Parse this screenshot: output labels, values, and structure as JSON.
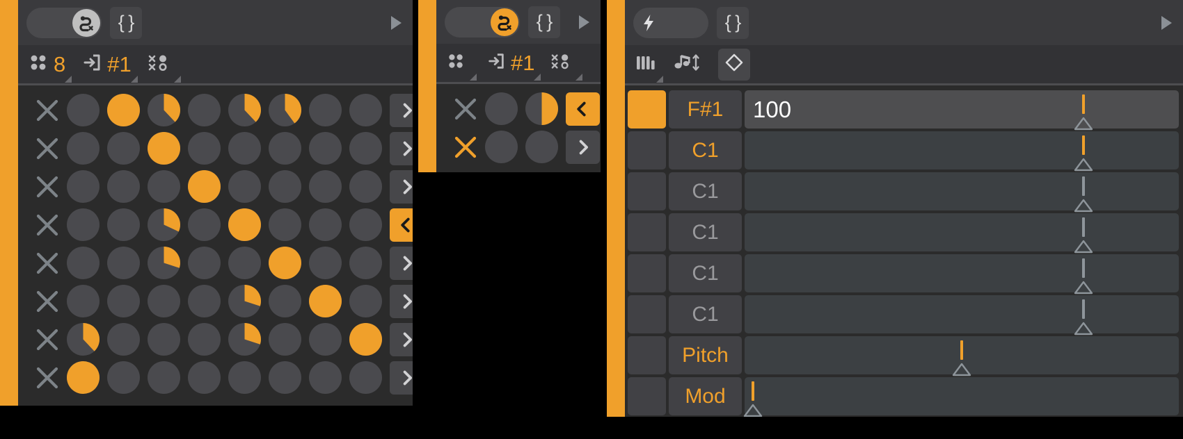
{
  "app": {
    "background": "#000000",
    "accent": "#f0a02b",
    "panel_bg": "#2b2b2b",
    "header_bg": "#3a3a3d",
    "toolbar_bg": "#323235",
    "step_off": "#4a4a4e"
  },
  "modules": [
    {
      "id": "probability",
      "name": "probability-sequencer",
      "header": {
        "toggle": {
          "name": "route-toggle",
          "icon": "route-cross-icon",
          "state": "off",
          "state_label": "off"
        },
        "braces": {
          "name": "expression-braces-button",
          "label": "{ }"
        },
        "play": {
          "name": "play-triangle-icon",
          "label": "▶"
        }
      },
      "toolbar": [
        {
          "name": "grid-mode-button",
          "icon": "four-dots-icon",
          "value": "8",
          "has_corner": true
        },
        {
          "name": "input-route-button",
          "icon": "enter-box-icon",
          "value": "#1",
          "has_corner": true
        },
        {
          "name": "randomize-button",
          "icon": "dots-crosses-icon",
          "value": "",
          "has_corner": true
        }
      ],
      "rows": [
        {
          "name": "step-row-1",
          "mute_icon": "x-icon",
          "mute_active": false,
          "steps": [
            0,
            100,
            38,
            0,
            38,
            40,
            0,
            0
          ],
          "arrow": {
            "icon": "chevron-right-icon",
            "label": "›",
            "active": false
          }
        },
        {
          "name": "step-row-2",
          "mute_icon": "x-icon",
          "mute_active": false,
          "steps": [
            0,
            0,
            100,
            0,
            0,
            0,
            0,
            0
          ],
          "arrow": {
            "icon": "chevron-right-icon",
            "label": "›",
            "active": false
          }
        },
        {
          "name": "step-row-3",
          "mute_icon": "x-icon",
          "mute_active": false,
          "steps": [
            0,
            0,
            0,
            100,
            0,
            0,
            0,
            0
          ],
          "arrow": {
            "icon": "chevron-right-icon",
            "label": "›",
            "active": false
          }
        },
        {
          "name": "step-row-4",
          "mute_icon": "x-icon",
          "mute_active": false,
          "steps": [
            0,
            0,
            32,
            0,
            100,
            0,
            0,
            0
          ],
          "arrow": {
            "icon": "chevron-left-icon",
            "label": "‹",
            "active": true
          }
        },
        {
          "name": "step-row-5",
          "mute_icon": "x-icon",
          "mute_active": false,
          "steps": [
            0,
            0,
            30,
            0,
            0,
            100,
            0,
            0
          ],
          "arrow": {
            "icon": "chevron-right-icon",
            "label": "›",
            "active": false
          }
        },
        {
          "name": "step-row-6",
          "mute_icon": "x-icon",
          "mute_active": false,
          "steps": [
            0,
            0,
            0,
            0,
            30,
            0,
            100,
            0
          ],
          "arrow": {
            "icon": "chevron-right-icon",
            "label": "›",
            "active": false
          }
        },
        {
          "name": "step-row-7",
          "mute_icon": "x-icon",
          "mute_active": false,
          "steps": [
            38,
            0,
            0,
            0,
            30,
            0,
            0,
            100
          ],
          "arrow": {
            "icon": "chevron-right-icon",
            "label": "›",
            "active": false
          }
        },
        {
          "name": "step-row-8",
          "mute_icon": "x-icon",
          "mute_active": false,
          "steps": [
            100,
            0,
            0,
            0,
            0,
            0,
            0,
            0
          ],
          "arrow": {
            "icon": "chevron-right-icon",
            "label": "›",
            "active": false
          }
        }
      ]
    },
    {
      "id": "secondary",
      "name": "secondary-sequencer",
      "header": {
        "toggle": {
          "name": "route-toggle",
          "icon": "route-cross-icon",
          "state": "on",
          "state_label": "on"
        },
        "braces": {
          "name": "expression-braces-button",
          "label": "{ }"
        },
        "play": {
          "name": "play-triangle-icon",
          "label": "▶"
        }
      },
      "toolbar": [
        {
          "name": "grid-mode-button",
          "icon": "four-dots-icon",
          "value": "",
          "has_corner": true
        },
        {
          "name": "input-route-button",
          "icon": "enter-box-icon",
          "value": "#1",
          "has_corner": true
        },
        {
          "name": "randomize-button",
          "icon": "dots-crosses-icon",
          "value": "",
          "has_corner": true
        }
      ],
      "rows": [
        {
          "name": "step-row-1",
          "mute_icon": "x-icon",
          "mute_active": false,
          "steps": [
            0,
            50
          ],
          "arrow": {
            "icon": "chevron-left-icon",
            "label": "‹",
            "active": true
          }
        },
        {
          "name": "step-row-2",
          "mute_icon": "x-icon",
          "mute_active": true,
          "steps": [
            0,
            0
          ],
          "arrow": {
            "icon": "chevron-right-icon",
            "label": "›",
            "active": false
          }
        }
      ]
    },
    {
      "id": "notes",
      "name": "note-lane-panel",
      "header": {
        "toggle": {
          "name": "trigger-toggle",
          "icon": "lightning-bolt-icon",
          "state": "off",
          "state_label": "off"
        },
        "braces": {
          "name": "expression-braces-button",
          "label": "{ }"
        },
        "play": {
          "name": "play-triangle-icon",
          "label": "▶"
        }
      },
      "toolbar": [
        {
          "name": "keyboard-range-button",
          "icon": "piano-keys-icon",
          "value": "",
          "has_corner": true
        },
        {
          "name": "note-transpose-button",
          "icon": "note-updown-icon",
          "value": "",
          "has_corner": false
        },
        {
          "name": "velocity-shape-button",
          "icon": "diamond-icon",
          "value": "",
          "has_corner": false,
          "boxed": true
        }
      ],
      "lanes": [
        {
          "name": "lane-1",
          "led_on": true,
          "label": "F#1",
          "label_hot": true,
          "value": "100",
          "focused": true,
          "slider_pct": 78,
          "handle_hot": true
        },
        {
          "name": "lane-2",
          "led_on": false,
          "label": "C1",
          "label_hot": true,
          "value": "",
          "focused": false,
          "slider_pct": 78,
          "handle_hot": true
        },
        {
          "name": "lane-3",
          "led_on": false,
          "label": "C1",
          "label_hot": false,
          "value": "",
          "focused": false,
          "slider_pct": 78,
          "handle_hot": false
        },
        {
          "name": "lane-4",
          "led_on": false,
          "label": "C1",
          "label_hot": false,
          "value": "",
          "focused": false,
          "slider_pct": 78,
          "handle_hot": false
        },
        {
          "name": "lane-5",
          "led_on": false,
          "label": "C1",
          "label_hot": false,
          "value": "",
          "focused": false,
          "slider_pct": 78,
          "handle_hot": false
        },
        {
          "name": "lane-6",
          "led_on": false,
          "label": "C1",
          "label_hot": false,
          "value": "",
          "focused": false,
          "slider_pct": 78,
          "handle_hot": false
        },
        {
          "name": "lane-7",
          "led_on": false,
          "label": "Pitch",
          "label_hot": true,
          "value": "",
          "focused": false,
          "slider_pct": 50,
          "handle_hot": true
        },
        {
          "name": "lane-8",
          "led_on": false,
          "label": "Mod",
          "label_hot": true,
          "value": "",
          "focused": false,
          "slider_pct": 2,
          "handle_hot": true
        }
      ]
    }
  ]
}
